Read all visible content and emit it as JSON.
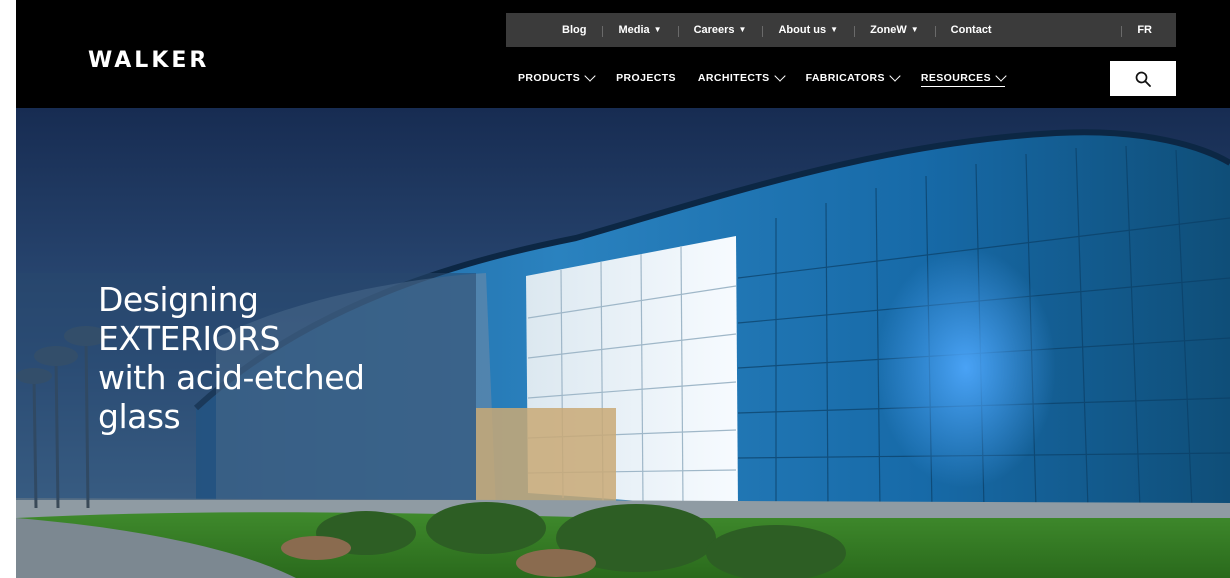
{
  "logo": {
    "text": "WALKER"
  },
  "utility_nav": {
    "items": [
      {
        "label": "Blog"
      },
      {
        "label": "Media"
      },
      {
        "label": "Careers"
      },
      {
        "label": "About us"
      },
      {
        "label": "ZoneW"
      },
      {
        "label": "Contact"
      },
      {
        "label": "FR"
      }
    ]
  },
  "main_nav": {
    "items": [
      {
        "label": "PRODUCTS"
      },
      {
        "label": "PROJECTS"
      },
      {
        "label": "ARCHITECTS"
      },
      {
        "label": "FABRICATORS"
      },
      {
        "label": "RESOURCES"
      }
    ]
  },
  "search": {
    "icon": "search-icon"
  },
  "hero": {
    "lines": [
      "Designing",
      "EXTERIORS",
      "with acid-etched",
      "glass"
    ]
  },
  "colors": {
    "header_bg": "#000000",
    "utility_bg": "#3b3b3b",
    "sky_top": "#172c52",
    "sky_bottom": "#5b86ab",
    "facade_blue": "#1d6fb0",
    "panel_overlay": "#28486e"
  }
}
